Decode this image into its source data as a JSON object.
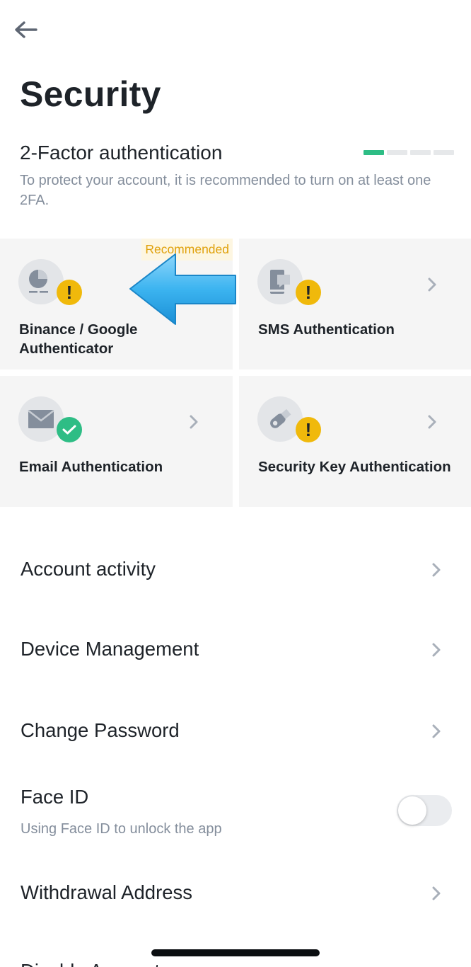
{
  "header": {
    "back_icon": "arrow-left-icon",
    "title": "Security"
  },
  "two_factor": {
    "title": "2-Factor authentication",
    "description": "To protect your account, it is recommended to turn on at least one 2FA.",
    "progress": {
      "enabled": 1,
      "total": 4
    }
  },
  "methods": [
    {
      "label_line1": "Binance / Google",
      "label_line2": "Authenticator",
      "badge": "Recommended",
      "icon": "authenticator-icon",
      "status": "warning"
    },
    {
      "label": "SMS Authentication",
      "icon": "phone-message-icon",
      "status": "warning"
    },
    {
      "label": "Email Authentication",
      "icon": "envelope-icon",
      "status": "enabled"
    },
    {
      "label": "Security Key Authentication",
      "icon": "usb-key-icon",
      "status": "warning"
    }
  ],
  "menu": {
    "account_activity": "Account activity",
    "device_management": "Device Management",
    "change_password": "Change Password",
    "face_id": "Face ID",
    "face_id_sub": "Using Face ID to unlock the app",
    "face_id_enabled": false,
    "withdrawal_address": "Withdrawal Address",
    "next_item_partial": "Disable Account"
  },
  "colors": {
    "accent_green": "#2ebd85",
    "warning_yellow": "#f0b90b",
    "overlay_arrow": "#3cb4f0"
  }
}
